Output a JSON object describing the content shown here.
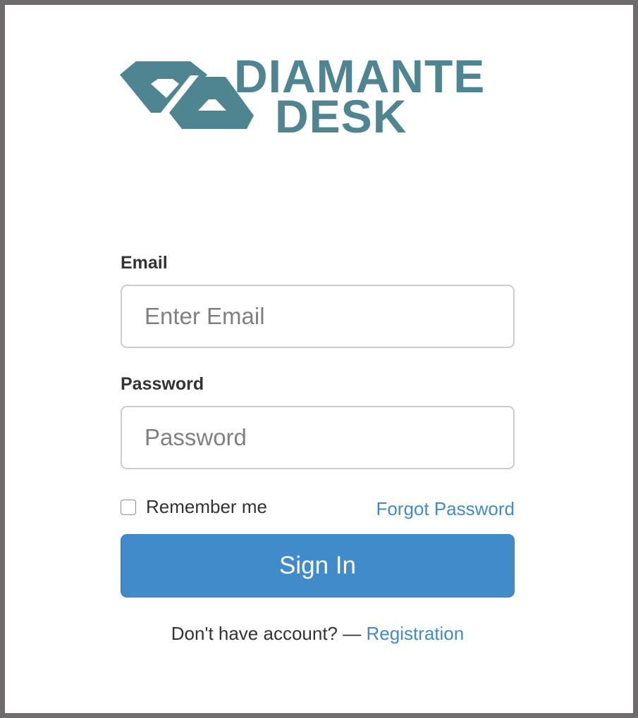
{
  "logo": {
    "line1": "DIAMANTE",
    "line2": "DESK",
    "color": "#4f8591"
  },
  "form": {
    "email_label": "Email",
    "email_placeholder": "Enter Email",
    "password_label": "Password",
    "password_placeholder": "Password",
    "remember_label": "Remember me",
    "remember_checked": false,
    "forgot_label": "Forgot Password",
    "signin_label": "Sign In",
    "no_account_text": "Don't have account? —",
    "registration_label": "Registration"
  },
  "colors": {
    "primary": "#428bca",
    "brand": "#4f8591"
  }
}
